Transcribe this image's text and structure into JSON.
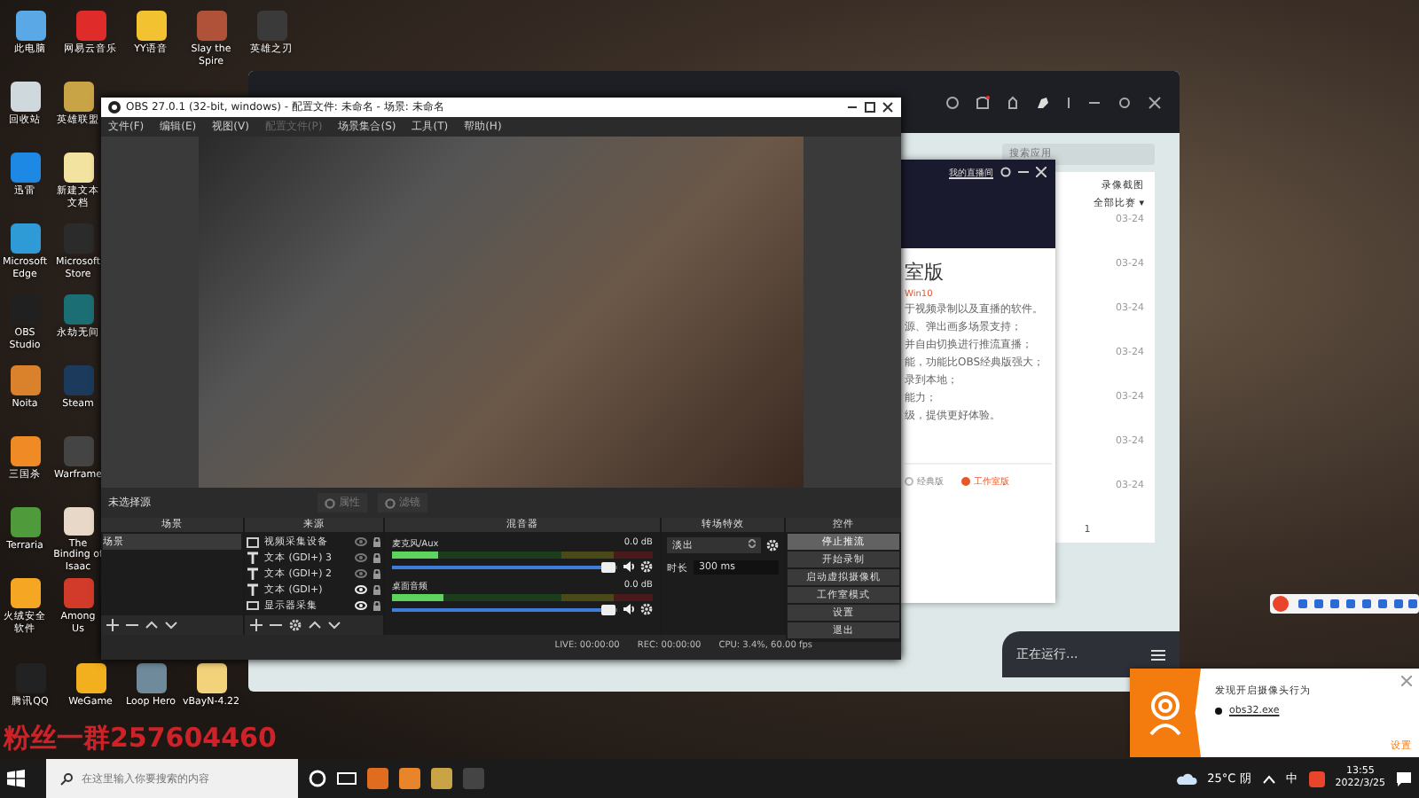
{
  "desktop": {
    "top_icons": [
      {
        "label": "此电脑",
        "color": "#5aa9e6"
      },
      {
        "label": "网易云音乐",
        "color": "#e02b2b"
      },
      {
        "label": "YY语音",
        "color": "#f2c230"
      },
      {
        "label": "Slay the Spire",
        "color": "#b0523a"
      },
      {
        "label": "英雄之刃",
        "color": "#3a3a3a"
      }
    ],
    "grid_icons": [
      {
        "label": "回收站",
        "color": "#cfd8dc"
      },
      {
        "label": "迅雷",
        "color": "#1e88e5"
      },
      {
        "label": "Microsoft Edge",
        "color": "#2e9bd6"
      },
      {
        "label": "OBS Studio",
        "color": "#202020"
      },
      {
        "label": "Noita",
        "color": "#d9822b"
      },
      {
        "label": "三国杀",
        "color": "#f08a24"
      },
      {
        "label": "Terraria",
        "color": "#4f9a3a"
      },
      {
        "label": "火绒安全软件",
        "color": "#f5a623"
      },
      {
        "label": "英雄联盟",
        "color": "#c9a447"
      },
      {
        "label": "新建文本文档",
        "color": "#f3e3a0"
      },
      {
        "label": "Microsoft Store",
        "color": "#2b2b2b"
      },
      {
        "label": "永劫无间",
        "color": "#1b6e74"
      },
      {
        "label": "Steam",
        "color": "#1b3a5c"
      },
      {
        "label": "Warframe",
        "color": "#444444"
      },
      {
        "label": "The Binding of Isaac",
        "color": "#e8d8c8"
      },
      {
        "label": "Among Us",
        "color": "#d23a2a"
      }
    ],
    "bottom_icons": [
      {
        "label": "腾讯QQ",
        "color": "#222222"
      },
      {
        "label": "WeGame",
        "color": "#f2b01e"
      },
      {
        "label": "Loop Hero",
        "color": "#6f8a9a"
      },
      {
        "label": "vBayN-4.22",
        "color": "#f2d27a"
      }
    ],
    "overlay_text": "粉丝一群257604460"
  },
  "obs": {
    "title": "OBS 27.0.1 (32-bit, windows) - 配置文件: 未命名 - 场景: 未命名",
    "menu": [
      {
        "label": "文件(F)",
        "disabled": false
      },
      {
        "label": "编辑(E)",
        "disabled": false
      },
      {
        "label": "视图(V)",
        "disabled": false
      },
      {
        "label": "配置文件(P)",
        "disabled": true
      },
      {
        "label": "场景集合(S)",
        "disabled": false
      },
      {
        "label": "工具(T)",
        "disabled": false
      },
      {
        "label": "帮助(H)",
        "disabled": false
      }
    ],
    "source_bar": {
      "label": "未选择源",
      "buttons": [
        {
          "label": "属性",
          "disabled": true
        },
        {
          "label": "滤镜",
          "disabled": true
        }
      ]
    },
    "scenes": {
      "title": "场景",
      "items": [
        {
          "label": "场景",
          "selected": true
        }
      ]
    },
    "sources": {
      "title": "来源",
      "items": [
        {
          "label": "视频采集设备",
          "kind": "camera",
          "visible": false
        },
        {
          "label": "文本 (GDI+) 3",
          "kind": "text",
          "visible": false
        },
        {
          "label": "文本 (GDI+) 2",
          "kind": "text",
          "visible": false
        },
        {
          "label": "文本 (GDI+)",
          "kind": "text",
          "visible": true
        },
        {
          "label": "显示器采集",
          "kind": "display",
          "visible": true
        }
      ]
    },
    "mixer": {
      "title": "混音器",
      "channels": [
        {
          "name": "麦克风/Aux",
          "reading": "0.0 dB",
          "level": 0.18,
          "fader": {
            "level": 0.96
          }
        },
        {
          "name": "桌面音频",
          "reading": "0.0 dB",
          "level": 0.2,
          "fader": {
            "level": 0.96
          }
        }
      ]
    },
    "transitions": {
      "title": "转场特效",
      "selected": "淡出",
      "duration_label": "时长",
      "duration": "300 ms"
    },
    "controls": {
      "title": "控件",
      "buttons": [
        {
          "label": "停止推流",
          "active": true
        },
        {
          "label": "开始录制",
          "active": false
        },
        {
          "label": "启动虚拟摄像机",
          "active": false
        },
        {
          "label": "工作室模式",
          "active": false
        },
        {
          "label": "设置",
          "active": false
        },
        {
          "label": "退出",
          "active": false
        }
      ]
    },
    "status": {
      "live": "LIVE: 00:00:00",
      "rec": "REC: 00:00:00",
      "cpu": "CPU: 3.4%, 60.00 fps"
    }
  },
  "game_app": {
    "search": {
      "placeholder": "搜索应用"
    },
    "tab": "录像截图",
    "filter": "全部比赛 ▾",
    "dates": [
      "03-24",
      "03-24",
      "03-24",
      "03-24",
      "03-24",
      "03-24",
      "03-24"
    ],
    "page": "1",
    "status": "正在运行..."
  },
  "popup": {
    "link": "我的直播间",
    "heading": "室版",
    "subtitle": "Win10",
    "lines": [
      "于视频录制以及直播的软件。",
      "源、弹出画多场景支持；",
      "并自由切换进行推流直播；",
      "能，功能比OBS经典版强大；",
      "录到本地；",
      "能力；",
      "级，提供更好体验。"
    ],
    "options": [
      {
        "label": "经典版",
        "selected": false
      },
      {
        "label": "工作室版",
        "selected": true
      }
    ]
  },
  "notification": {
    "message": "发现开启摄像头行为",
    "process": "obs32.exe",
    "settings": "设置"
  },
  "taskbar": {
    "search": {
      "placeholder": "在这里输入你要搜索的内容"
    },
    "weather": "25°C 阴",
    "ime": "中",
    "time": "13:55",
    "date": "2022/3/25"
  }
}
